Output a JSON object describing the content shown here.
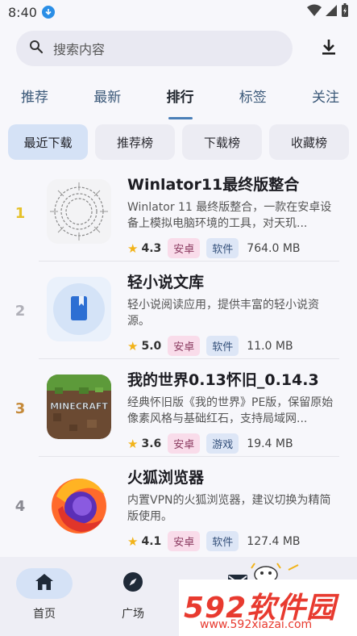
{
  "status": {
    "time": "8:40"
  },
  "search": {
    "placeholder": "搜索内容"
  },
  "tabs": [
    {
      "label": "推荐"
    },
    {
      "label": "最新"
    },
    {
      "label": "排行"
    },
    {
      "label": "标签"
    },
    {
      "label": "关注"
    }
  ],
  "active_tab": "排行",
  "chips": [
    {
      "label": "最近下载"
    },
    {
      "label": "推荐榜"
    },
    {
      "label": "下载榜"
    },
    {
      "label": "收藏榜"
    }
  ],
  "apps": [
    {
      "rank": "1",
      "rank_color": "#e6c12a",
      "title": "Winlator11最终版整合",
      "desc": "Winlator 11 最终版整合，一款在安卓设备上模拟电脑环境的工具，对天玑...",
      "rating": "4.3",
      "os": "安卓",
      "category": "软件",
      "size": "764.0 MB"
    },
    {
      "rank": "2",
      "rank_color": "#b0b0b8",
      "title": "轻小说文库",
      "desc": "轻小说阅读应用，提供丰富的轻小说资源。",
      "rating": "5.0",
      "os": "安卓",
      "category": "软件",
      "size": "11.0 MB"
    },
    {
      "rank": "3",
      "rank_color": "#c58a3a",
      "title": "我的世界0.13怀旧_0.14.3",
      "desc": "经典怀旧版《我的世界》PE版，保留原始像素风格与基础红石，支持局域网...",
      "rating": "3.6",
      "os": "安卓",
      "category": "游戏",
      "size": "19.4 MB"
    },
    {
      "rank": "4",
      "rank_color": "#8a8a92",
      "title": "火狐浏览器",
      "desc": "内置VPN的火狐浏览器，建议切换为精简版使用。",
      "rating": "4.1",
      "os": "安卓",
      "category": "软件",
      "size": "127.4 MB"
    }
  ],
  "minecraft_logo_text": "MINECRAFT",
  "bottom_nav": [
    {
      "label": "首页"
    },
    {
      "label": "广场"
    }
  ],
  "watermark": {
    "main": "592软件园",
    "sub": "www.592xiazai.com"
  },
  "colors": {
    "accent": "#4a7fb8",
    "chip_active": "#d5e2f6",
    "star": "#f2b318",
    "watermark": "#e83a2f"
  }
}
